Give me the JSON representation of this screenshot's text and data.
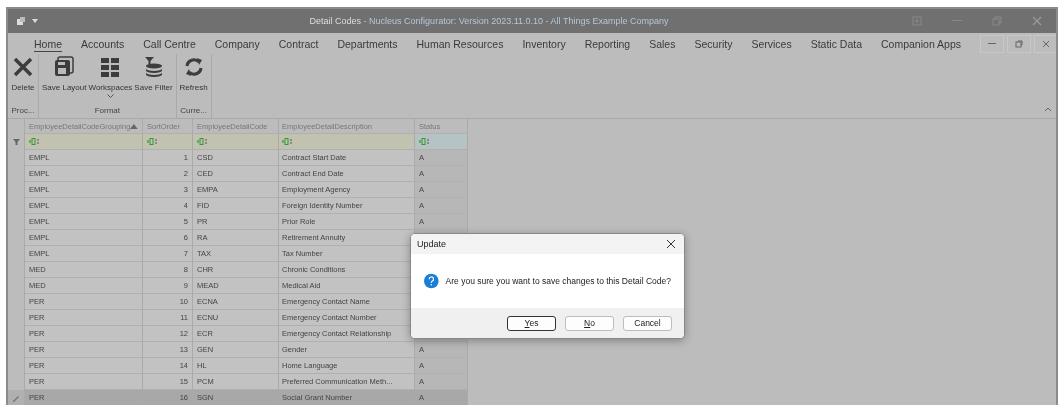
{
  "window": {
    "title": "Detail Codes",
    "subtitle": " - Nucleus Configurator: Version 2023.11.0.10 - All Things Example Company"
  },
  "menu": [
    {
      "label": "Home",
      "selected": true
    },
    {
      "label": "Accounts",
      "selected": false
    },
    {
      "label": "Call Centre",
      "selected": false
    },
    {
      "label": "Company",
      "selected": false
    },
    {
      "label": "Contract",
      "selected": false
    },
    {
      "label": "Departments",
      "selected": false
    },
    {
      "label": "Human Resources",
      "selected": false
    },
    {
      "label": "Inventory",
      "selected": false
    },
    {
      "label": "Reporting",
      "selected": false
    },
    {
      "label": "Sales",
      "selected": false
    },
    {
      "label": "Security",
      "selected": false
    },
    {
      "label": "Services",
      "selected": false
    },
    {
      "label": "Static Data",
      "selected": false
    },
    {
      "label": "Companion Apps",
      "selected": false
    }
  ],
  "ribbon": [
    {
      "label": "Proc...",
      "buttons": [
        {
          "label": "Delete",
          "kind": "delete",
          "dropdown": false
        }
      ]
    },
    {
      "label": "Format",
      "buttons": [
        {
          "label": "Save Layout",
          "kind": "save",
          "dropdown": false
        },
        {
          "label": "Workspaces",
          "kind": "grid",
          "dropdown": true
        },
        {
          "label": "Save Filter",
          "kind": "filter",
          "dropdown": false
        }
      ]
    },
    {
      "label": "Curre...",
      "buttons": [
        {
          "label": "Refresh",
          "kind": "refresh",
          "dropdown": false
        }
      ]
    }
  ],
  "table": {
    "columns": [
      {
        "label": "EmployeeDetailCodeGrouping",
        "sorted": true
      },
      {
        "label": "SortOrder",
        "sorted": false
      },
      {
        "label": "EmployeeDetailCode",
        "sorted": false
      },
      {
        "label": "EmployeeDetailDescription",
        "sorted": false
      },
      {
        "label": "Status",
        "sorted": false
      }
    ],
    "rows": [
      {
        "cells": [
          "EMPL",
          "1",
          "CSD",
          "Contract Start Date",
          "A"
        ],
        "selected": false
      },
      {
        "cells": [
          "EMPL",
          "2",
          "CED",
          "Contract End Date",
          "A"
        ],
        "selected": false
      },
      {
        "cells": [
          "EMPL",
          "3",
          "EMPA",
          "Employment Agency",
          "A"
        ],
        "selected": false
      },
      {
        "cells": [
          "EMPL",
          "4",
          "FID",
          "Foreign Identity Number",
          "A"
        ],
        "selected": false
      },
      {
        "cells": [
          "EMPL",
          "5",
          "PR",
          "Prior Role",
          "A"
        ],
        "selected": false
      },
      {
        "cells": [
          "EMPL",
          "6",
          "RA",
          "Retirement Annuity"
        ],
        "selected": false
      },
      {
        "cells": [
          "EMPL",
          "7",
          "TAX",
          "Tax Number"
        ],
        "selected": false
      },
      {
        "cells": [
          "MED",
          "8",
          "CHR",
          "Chronic Conditions"
        ],
        "selected": false
      },
      {
        "cells": [
          "MED",
          "9",
          "MEAD",
          "Medical Aid"
        ],
        "selected": false
      },
      {
        "cells": [
          "PER",
          "10",
          "ECNA",
          "Emergency Contact Name"
        ],
        "selected": false
      },
      {
        "cells": [
          "PER",
          "11",
          "ECNU",
          "Emergency Contact Number"
        ],
        "selected": false
      },
      {
        "cells": [
          "PER",
          "12",
          "ECR",
          "Emergency Contact Relationship"
        ],
        "selected": false
      },
      {
        "cells": [
          "PER",
          "13",
          "GEN",
          "Gender",
          "A"
        ],
        "selected": false
      },
      {
        "cells": [
          "PER",
          "14",
          "HL",
          "Home Language",
          "A"
        ],
        "selected": false
      },
      {
        "cells": [
          "PER",
          "15",
          "PCM",
          "Preferred Communication Meth...",
          "A"
        ],
        "selected": false
      },
      {
        "cells": [
          "PER",
          "16",
          "SGN",
          "Social Grant Number",
          "A"
        ],
        "selected": true
      }
    ]
  },
  "dialog": {
    "title": "Update",
    "message": "Are you sure you want to save changes to this Detail Code?",
    "buttons": [
      {
        "label": "Yes",
        "default": true
      },
      {
        "label": "No",
        "default": false
      },
      {
        "label": "Cancel",
        "default": false
      }
    ]
  }
}
